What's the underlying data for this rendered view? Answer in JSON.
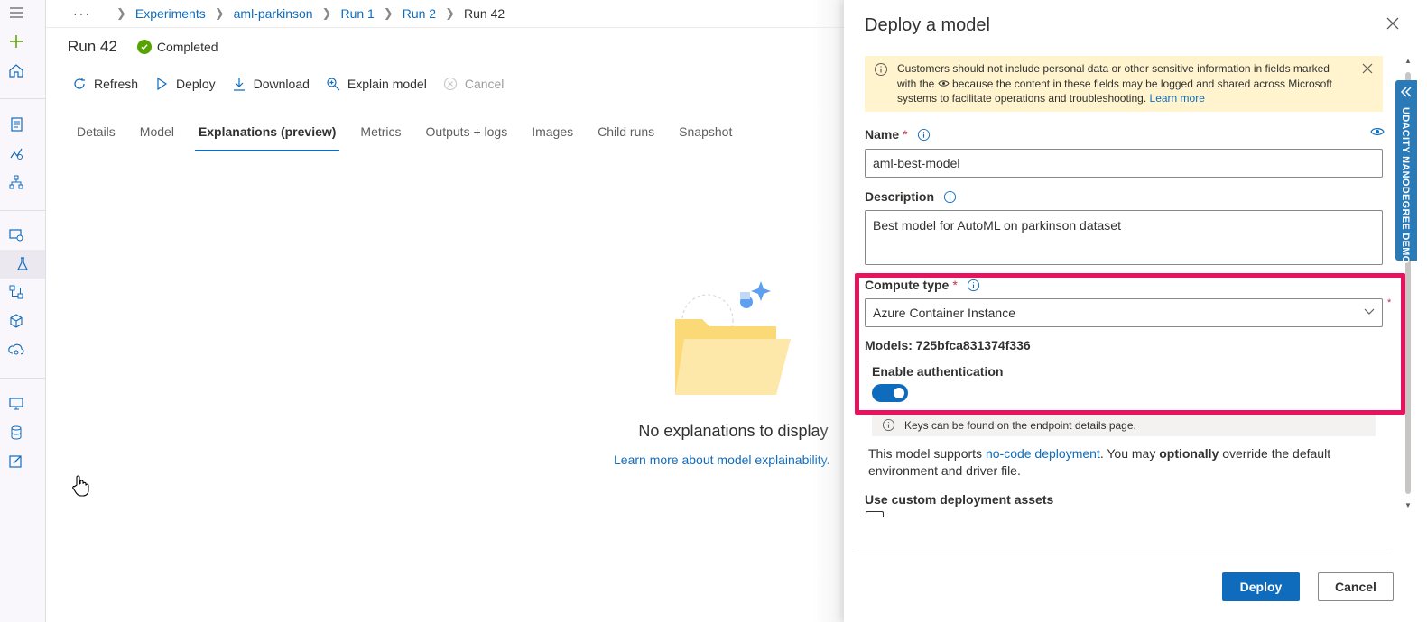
{
  "breadcrumb": {
    "more": "···",
    "items": [
      "Experiments",
      "aml-parkinson",
      "Run 1",
      "Run 2"
    ],
    "current": "Run 42"
  },
  "run": {
    "title": "Run 42",
    "status": "Completed"
  },
  "toolbar": {
    "refresh": "Refresh",
    "deploy": "Deploy",
    "download": "Download",
    "explain": "Explain model",
    "cancel": "Cancel"
  },
  "tabs": [
    "Details",
    "Model",
    "Explanations (preview)",
    "Metrics",
    "Outputs + logs",
    "Images",
    "Child runs",
    "Snapshot"
  ],
  "active_tab": "Explanations (preview)",
  "empty_state": {
    "title": "No explanations to display",
    "link": "Learn more about model explainability."
  },
  "panel": {
    "title": "Deploy a model",
    "warning_pre": "Customers should not include personal data or other sensitive information in fields marked with the",
    "warning_post": "because the content in these fields may be logged and shared across Microsoft systems to facilitate operations and troubleshooting.",
    "warning_link": "Learn more",
    "name_label": "Name",
    "required_mark": "*",
    "name_value": "aml-best-model",
    "description_label": "Description",
    "description_value": "Best model for AutoML on parkinson dataset",
    "compute_label": "Compute type",
    "compute_value": "Azure Container Instance",
    "models_text": "Models: 725bfca831374f336",
    "auth_label": "Enable authentication",
    "auth_enabled": true,
    "keys_note": "Keys can be found on the endpoint details page.",
    "support_pre": "This model supports",
    "support_link": "no-code deployment",
    "support_mid": ". You may",
    "support_bold": "optionally",
    "support_post": "override the default environment and driver file.",
    "custom_assets_label": "Use custom deployment assets",
    "deploy_button": "Deploy",
    "cancel_button": "Cancel"
  },
  "side_tab": "UDACITY NANODEGREE DEMO",
  "colors": {
    "accent": "#0f6cbd",
    "highlight": "#e8135f",
    "warning_bg": "#fff4ce",
    "success": "#57a300"
  }
}
